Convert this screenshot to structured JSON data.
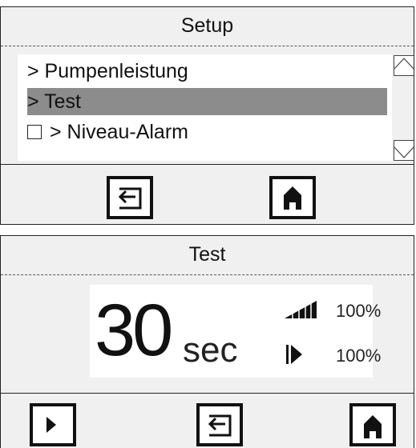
{
  "setup_panel": {
    "title": "Setup",
    "menu_items": [
      {
        "label": "> Pumpenleistung",
        "selected": false,
        "checkbox": false
      },
      {
        "label": "> Test",
        "selected": true,
        "checkbox": false
      },
      {
        "label": "> Niveau-Alarm",
        "selected": false,
        "checkbox": true
      }
    ]
  },
  "test_panel": {
    "title": "Test",
    "value": "30",
    "unit": "sec",
    "power_percent": "100%",
    "flow_percent": "100%"
  },
  "colors": {
    "panel_bg": "#f0f0f0",
    "highlight": "#8c8c8c",
    "content_bg": "#ffffff",
    "ink": "#111111"
  },
  "icons": [
    "back-icon",
    "home-icon",
    "scroll-up-icon",
    "scroll-down-icon",
    "play-icon",
    "signal-strength-icon",
    "flow-icon"
  ]
}
